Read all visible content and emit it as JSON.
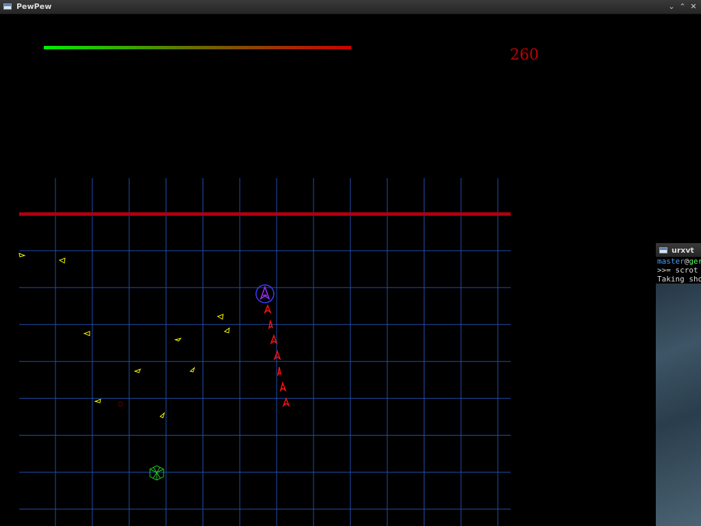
{
  "window": {
    "title": "PewPew",
    "controls": [
      "minimize",
      "maximize",
      "close"
    ]
  },
  "hud": {
    "score": "260",
    "health_fraction": 1.0,
    "health_colors": [
      "#00ee00",
      "#cc0000"
    ]
  },
  "colors": {
    "grid": "#1f4fb0",
    "barrier": "#b00010",
    "enemy": "#ffff00",
    "player": "#9b30ff",
    "player_ring": "#3c3cff",
    "bullet": "#ff1010",
    "cube": "#20d020",
    "mine": "#cc0000"
  },
  "terminal": {
    "title": "urxvt",
    "user": "master",
    "at": "@",
    "host": "ger",
    "line2": ">>= scrot",
    "line3": "Taking sho"
  }
}
